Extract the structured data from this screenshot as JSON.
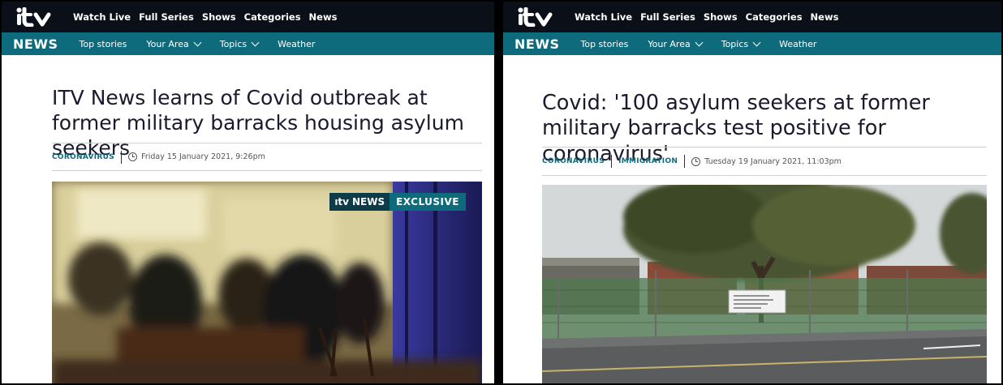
{
  "panels": [
    {
      "logo": "itv",
      "nav": [
        "Watch Live",
        "Full Series",
        "Shows",
        "Categories",
        "News"
      ],
      "news_label": "NEWS",
      "subnav": [
        {
          "label": "Top stories"
        },
        {
          "label": "Your Area"
        },
        {
          "label": "Topics"
        },
        {
          "label": "Weather"
        }
      ],
      "headline": "ITV News learns of Covid outbreak at former military barracks housing asylum seekers",
      "tags": [
        "CORONAVIRUS"
      ],
      "date": "Friday 15 January 2021, 9:26pm",
      "image_badge": {
        "brand": "NEWS",
        "label": "EXCLUSIVE"
      }
    },
    {
      "logo": "itv",
      "nav": [
        "Watch Live",
        "Full Series",
        "Shows",
        "Categories",
        "News"
      ],
      "news_label": "NEWS",
      "subnav": [
        {
          "label": "Top stories"
        },
        {
          "label": "Your Area"
        },
        {
          "label": "Topics"
        },
        {
          "label": "Weather"
        }
      ],
      "headline": "Covid: '100 asylum seekers at former military barracks test positive for coronavirus'",
      "tags": [
        "CORONAVIRUS",
        "IMMIGRATION"
      ],
      "date": "Tuesday 19 January 2021, 11:03pm"
    }
  ]
}
